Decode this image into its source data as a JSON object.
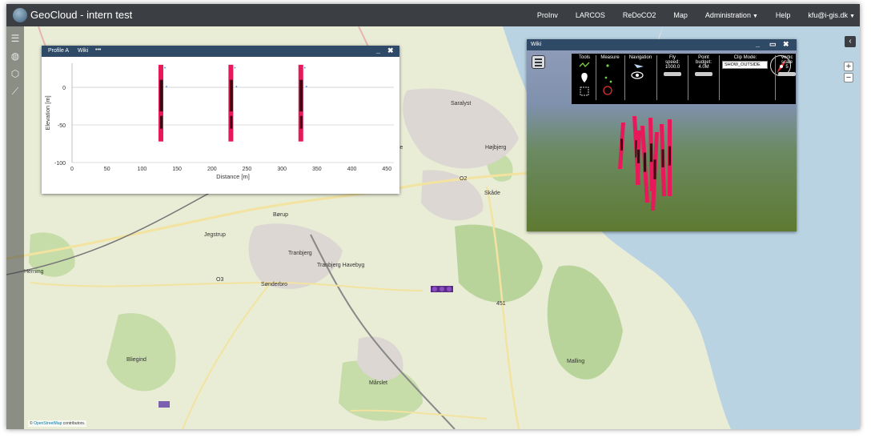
{
  "app": {
    "title": "GeoCloud - intern test"
  },
  "nav": {
    "items": [
      {
        "label": "ProInv",
        "caret": false
      },
      {
        "label": "LARCOS",
        "caret": false
      },
      {
        "label": "ReDoCO2",
        "caret": false
      },
      {
        "label": "Map",
        "caret": false
      },
      {
        "label": "Administration",
        "caret": true
      },
      {
        "label": "Help",
        "caret": false
      },
      {
        "label": "kfu@i-gis.dk",
        "caret": true
      }
    ]
  },
  "sidebar": {
    "icons": [
      "layers-icon",
      "globe-icon",
      "cube-icon",
      "chart-icon"
    ]
  },
  "map": {
    "labels": [
      "Saralyst",
      "Højbjerg",
      "Holme",
      "Skåde",
      "Børup",
      "Jegstrup",
      "Tranbjerg",
      "Tranbjerg Havebyg",
      "Sønderbro",
      "Herning",
      "Mårslet",
      "Bliegind",
      "O2",
      "O3",
      "451",
      "Malling"
    ],
    "attribution_prefix": "© ",
    "attribution_link": "OpenStreetMap",
    "attribution_suffix": " contributors."
  },
  "zoom": {
    "plus": "+",
    "minus": "−"
  },
  "collapse": "‹",
  "profile_window": {
    "title": "Profile A",
    "tab": "Wiki",
    "menu": "•••",
    "minimize": "_",
    "close": "✖"
  },
  "wiki_window": {
    "title": "Wiki",
    "minimize": "_",
    "maximize": "▭",
    "close": "✖",
    "toolbar": {
      "tools_label": "Tools",
      "measure_label": "Measure",
      "navigation_label": "Navigation",
      "fly_label_1": "Fly",
      "fly_label_2": "speed:",
      "fly_value": "1000.0",
      "budget_label_1": "Point",
      "budget_label_2": "budget:",
      "budget_value": "4.0M",
      "clip_label": "Clip Mode:",
      "clip_value": "SHOW_OUTSIDE",
      "vertical_label": "Vertic",
      "vertical_label_2": "scale",
      "vertical_value": "5"
    }
  },
  "chart_data": {
    "type": "scatter",
    "title": "",
    "xlabel": "Distance [m]",
    "ylabel": "Elevation [m]",
    "xlim": [
      0,
      460
    ],
    "ylim": [
      -100,
      32
    ],
    "x_ticks": [
      0,
      50,
      100,
      150,
      200,
      250,
      300,
      350,
      400,
      450
    ],
    "y_ticks": [
      0,
      -50,
      -100
    ],
    "grid": "horizontal",
    "series": [
      {
        "x": 127,
        "top": 30,
        "bottom": -72
      },
      {
        "x": 227,
        "top": 30,
        "bottom": -72
      },
      {
        "x": 327,
        "top": 30,
        "bottom": -72
      }
    ]
  },
  "colors": {
    "navbar": "#3b3e42",
    "window_header": "#2f4a66",
    "borehole": "#e8195a",
    "borehole_dark": "#3a0a10",
    "water": "#b9d3e3",
    "land": "#e9edd6",
    "forest": "#b9d49b"
  }
}
